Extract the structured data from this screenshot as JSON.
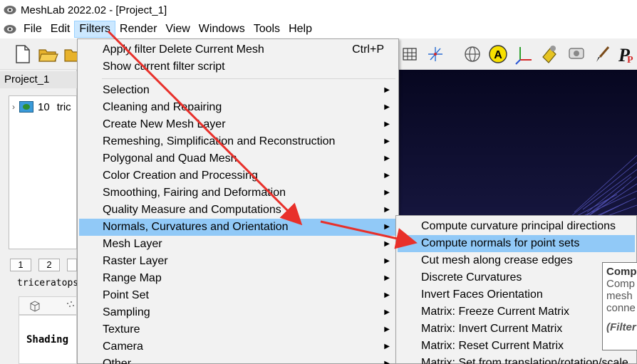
{
  "window": {
    "title": "MeshLab 2022.02 - [Project_1]"
  },
  "menubar": {
    "items": [
      "File",
      "Edit",
      "Filters",
      "Render",
      "View",
      "Windows",
      "Tools",
      "Help"
    ],
    "active": "Filters"
  },
  "left_panel": {
    "project_title": "Project_1",
    "layer": {
      "number": "10",
      "name": "tric"
    },
    "buttons": [
      "1",
      "2"
    ],
    "mesh_name": "triceratops",
    "shading_label": "Shading"
  },
  "filters_menu": {
    "top_items": [
      {
        "label": "Apply filter Delete Current Mesh",
        "shortcut": "Ctrl+P"
      },
      {
        "label": "Show current filter script",
        "shortcut": ""
      }
    ],
    "categories": [
      "Selection",
      "Cleaning and Repairing",
      "Create New Mesh Layer",
      "Remeshing, Simplification and Reconstruction",
      "Polygonal and Quad Mesh",
      "Color Creation and Processing",
      "Smoothing, Fairing and Deformation",
      "Quality Measure and Computations",
      "Normals, Curvatures and Orientation",
      "Mesh Layer",
      "Raster Layer",
      "Range Map",
      "Point Set",
      "Sampling",
      "Texture",
      "Camera",
      "Other"
    ],
    "highlighted": "Normals, Curvatures and Orientation"
  },
  "submenu": {
    "items": [
      "Compute curvature principal directions",
      "Compute normals for point sets",
      "Cut mesh along crease edges",
      "Discrete Curvatures",
      "Invert Faces Orientation",
      "Matrix: Freeze Current Matrix",
      "Matrix: Invert Current Matrix",
      "Matrix: Reset Current Matrix",
      "Matrix: Set from translation/rotation/scale"
    ],
    "highlighted": "Compute normals for point sets"
  },
  "tooltip": {
    "title": "Comp",
    "lines": [
      "Comp",
      "mesh",
      "conne"
    ],
    "footer": "(Filter"
  },
  "colors": {
    "highlight": "#91c9f7",
    "arrow": "#e8302a",
    "menubar_active": "#cce8ff"
  }
}
